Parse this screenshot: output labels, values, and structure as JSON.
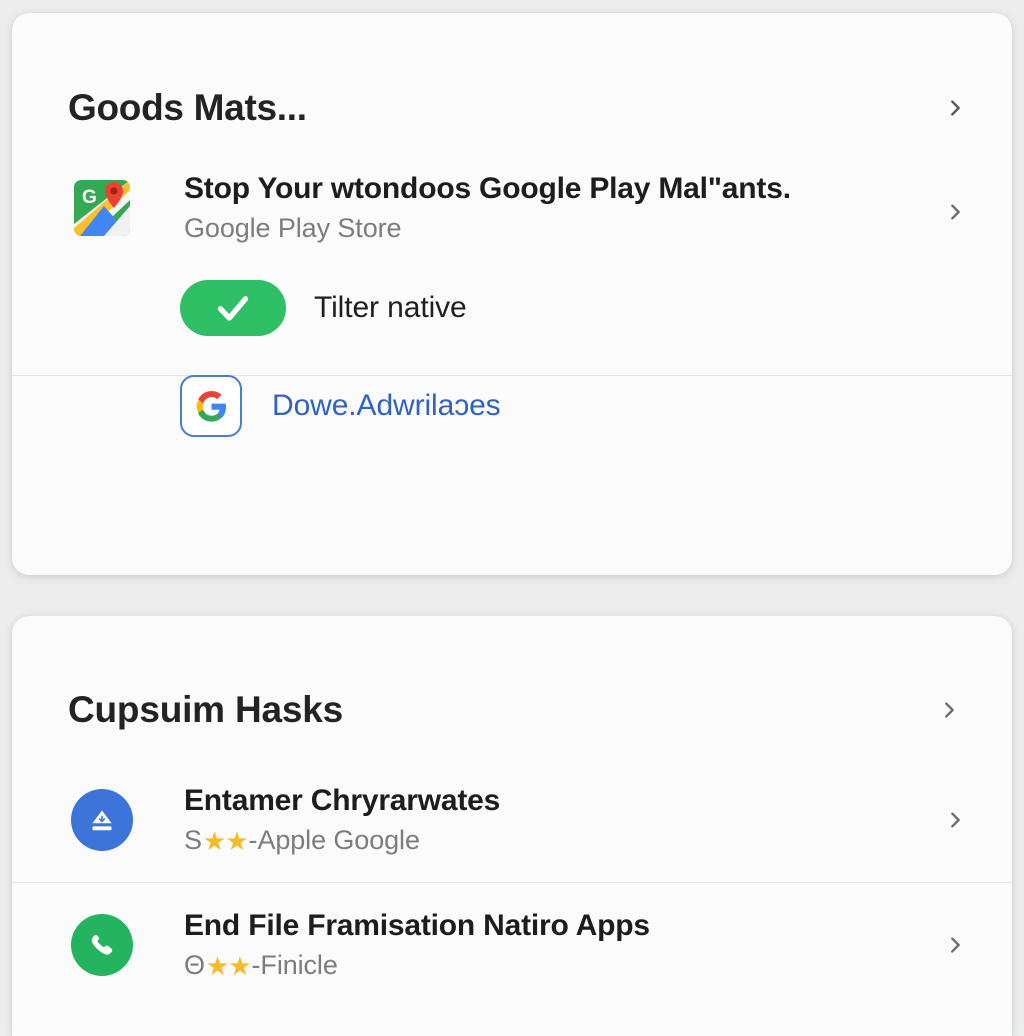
{
  "theme": {
    "page_bg": "#ececed",
    "card_bg": "#fbfbfb",
    "title_color": "#232323",
    "subtitle_color": "#7b7d80",
    "link_color": "#2f62c4",
    "toggle_green": "#2fbf64",
    "star_color": "#f5bb2b",
    "blue_circle": "#3d74d9",
    "green_circle": "#24b35f"
  },
  "cards": [
    {
      "header": {
        "title": "Goods Mats...",
        "chevron": "chevron-right-icon"
      },
      "app_row": {
        "icon": "google-maps-icon",
        "title": "Stop Your wtondoos Google Play Mal\"ants.",
        "subtitle": "Google Play Store",
        "chevron": "chevron-right-icon"
      },
      "toggle_row": {
        "icon": "check-icon",
        "state": "on",
        "label": "Tilter native"
      },
      "link_row": {
        "icon": "google-g-icon",
        "label": "Dowe.Adwrilaɔes"
      }
    },
    {
      "header": {
        "title": "Cupsuim Hasks",
        "chevron": "chevron-right-icon"
      },
      "items": [
        {
          "icon": "eject-icon",
          "icon_color": "#3d74d9",
          "title": "Entamer Chryrarwates",
          "sub_prefix": "S",
          "stars": "★★",
          "sub_suffix": "-Apple Google",
          "chevron": "chevron-right-icon"
        },
        {
          "icon": "phone-icon",
          "icon_color": "#24b35f",
          "title": "End File Framisation Natiro Apps",
          "sub_prefix": "Θ",
          "stars": "★★",
          "sub_suffix": "-Finicle",
          "chevron": "chevron-right-icon"
        }
      ]
    }
  ]
}
